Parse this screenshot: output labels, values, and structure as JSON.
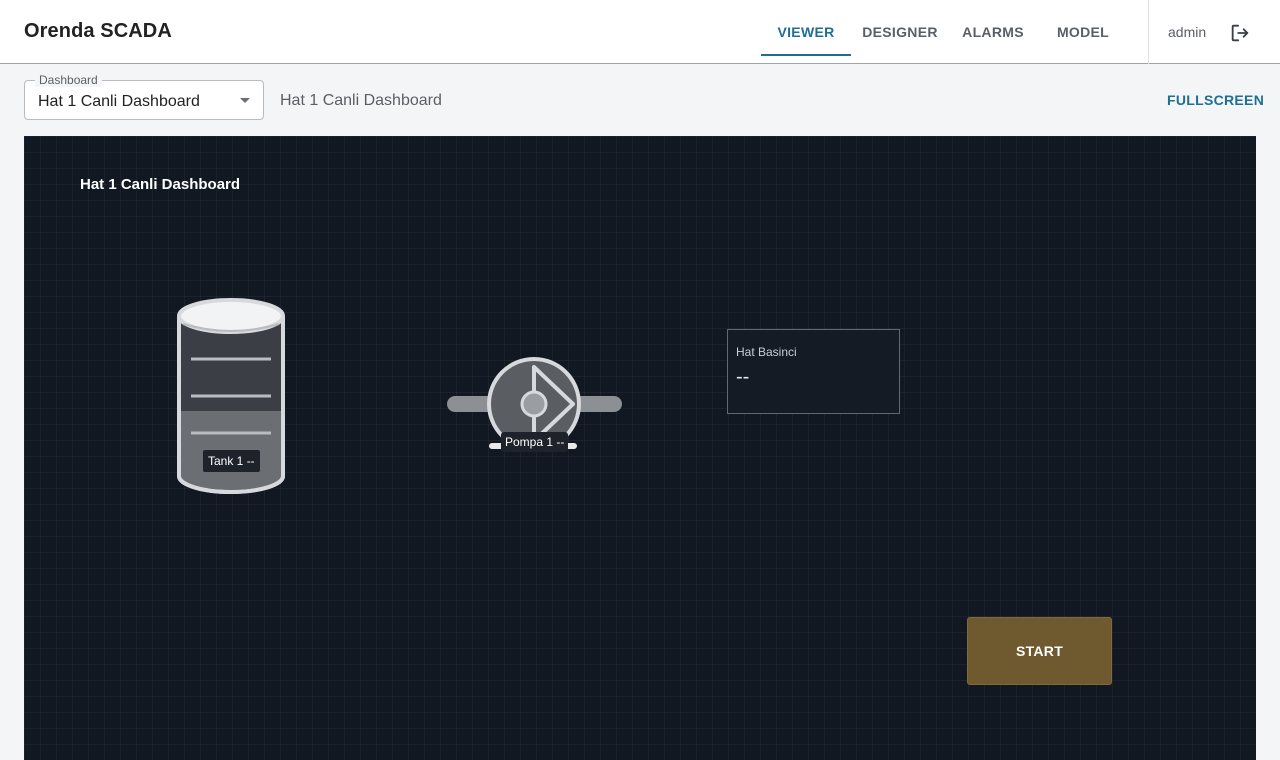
{
  "app": {
    "title": "Orenda SCADA"
  },
  "nav": {
    "tabs": [
      {
        "label": "VIEWER",
        "active": true
      },
      {
        "label": "DESIGNER",
        "active": false
      },
      {
        "label": "ALARMS",
        "active": false
      },
      {
        "label": "MODEL",
        "active": false
      }
    ],
    "user": "admin",
    "logout_icon": "logout-icon"
  },
  "toolbar": {
    "dashboard_select": {
      "legend": "Dashboard",
      "value": "Hat 1 Canli Dashboard"
    },
    "title": "Hat 1 Canli Dashboard",
    "fullscreen_label": "FULLSCREEN"
  },
  "canvas": {
    "title": "Hat 1 Canli Dashboard",
    "tank": {
      "label": "Tank 1 --",
      "icon": "tank-icon"
    },
    "pump": {
      "label": "Pompa 1 --",
      "icon": "pump-icon"
    },
    "gauge": {
      "label": "Hat Basinci",
      "value": "--"
    },
    "start_button": {
      "label": "START"
    }
  },
  "colors": {
    "accent": "#1f6f93",
    "canvas_bg": "#121821",
    "start_button": "#6f5a30"
  }
}
